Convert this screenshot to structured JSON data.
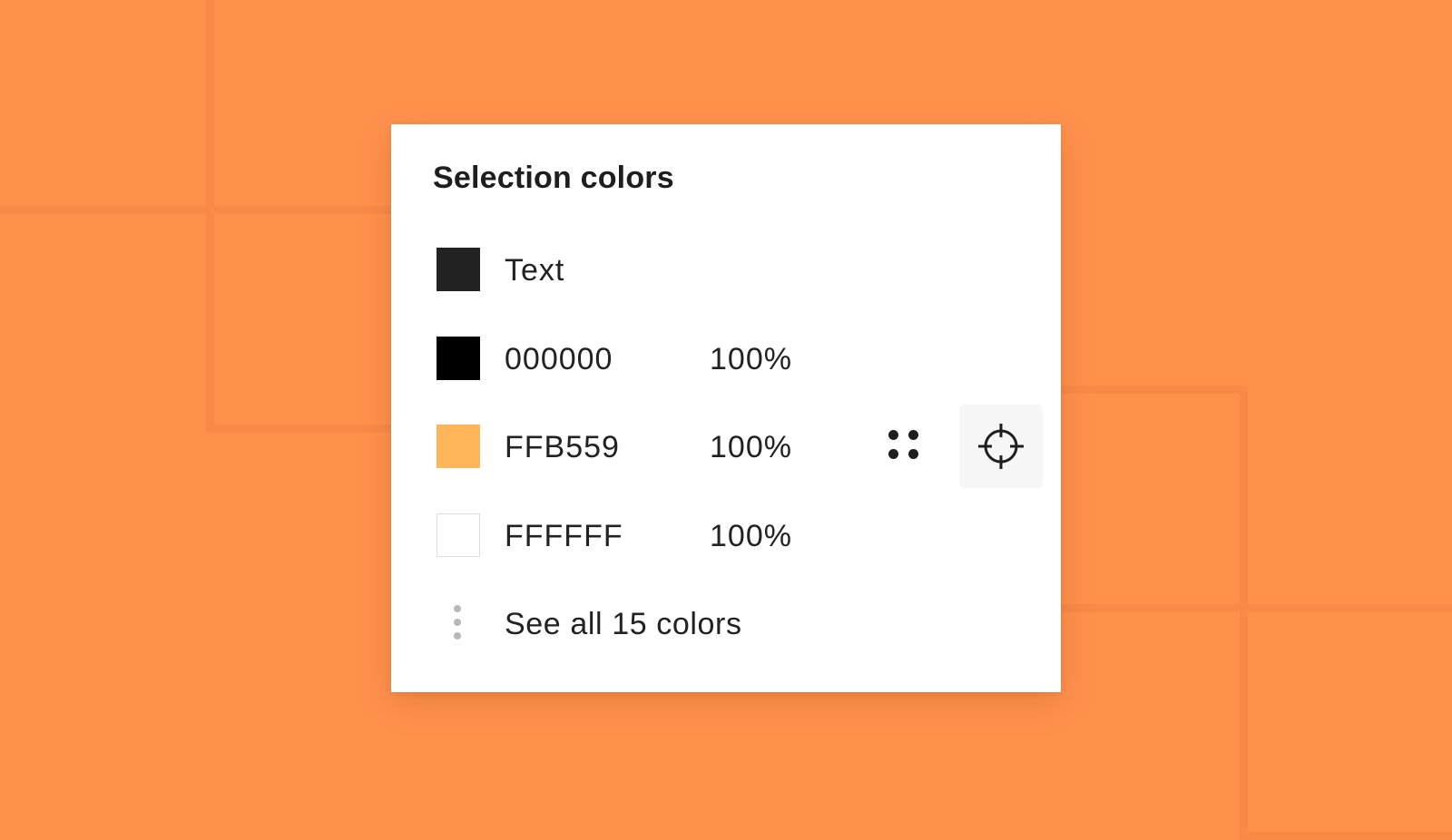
{
  "panel": {
    "title": "Selection colors",
    "rows": [
      {
        "swatch_color": "#222222",
        "label": "Text",
        "opacity": ""
      },
      {
        "swatch_color": "#000000",
        "label": "000000",
        "opacity": "100%"
      },
      {
        "swatch_color": "#FFB559",
        "label": "FFB559",
        "opacity": "100%"
      },
      {
        "swatch_color": "#FFFFFF",
        "label": "FFFFFF",
        "opacity": "100%"
      }
    ],
    "see_all_label": "See all 15 colors",
    "hover_row_icons": [
      "grid-dots-icon",
      "target-icon"
    ]
  },
  "colors": {
    "background": "#FF914D",
    "background_outline": "#F88A48",
    "panel_background": "#FFFFFF",
    "text": "#222222",
    "target_button_background": "#F6F6F6",
    "swatch_border": "#DDDDDD"
  }
}
